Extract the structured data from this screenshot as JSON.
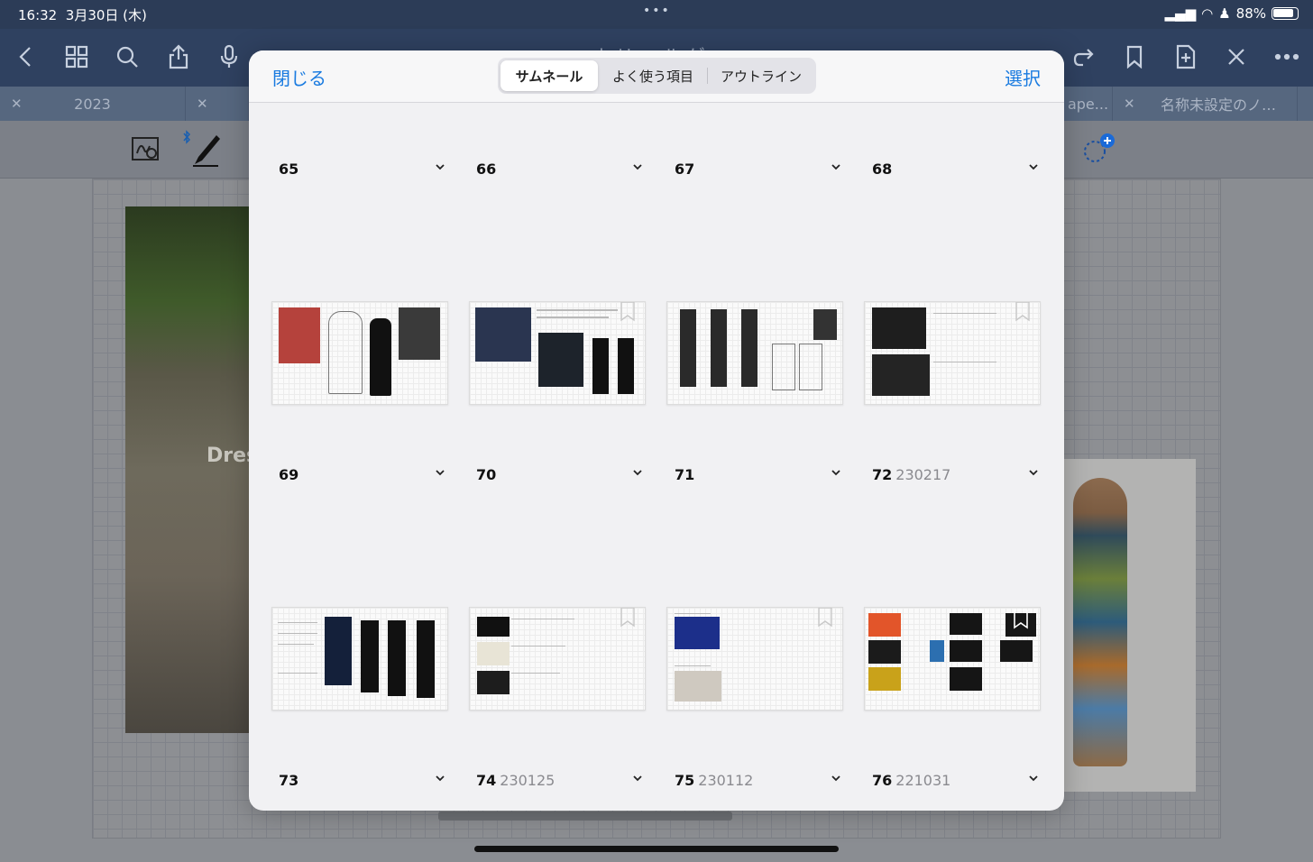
{
  "status_bar": {
    "time": "16:32",
    "date": "3月30日 (木)",
    "battery": "88%"
  },
  "app": {
    "title": "ー ナ リ ー ル ゲ"
  },
  "tabs": [
    {
      "label": "2023"
    },
    {
      "label": ""
    },
    {
      "label": "ape..."
    },
    {
      "label": "名称未設定のノ…"
    }
  ],
  "canvas": {
    "overlay_text": "Dres"
  },
  "modal": {
    "close_label": "閉じる",
    "select_label": "選択",
    "segments": [
      "サムネール",
      "よく使う項目",
      "アウトライン"
    ],
    "active_segment": "サムネール"
  },
  "pages": [
    {
      "num": "65",
      "sub": ""
    },
    {
      "num": "66",
      "sub": ""
    },
    {
      "num": "67",
      "sub": ""
    },
    {
      "num": "68",
      "sub": ""
    },
    {
      "num": "69",
      "sub": ""
    },
    {
      "num": "70",
      "sub": ""
    },
    {
      "num": "71",
      "sub": ""
    },
    {
      "num": "72",
      "sub": "230217"
    },
    {
      "num": "73",
      "sub": ""
    },
    {
      "num": "74",
      "sub": "230125"
    },
    {
      "num": "75",
      "sub": "230112"
    },
    {
      "num": "76",
      "sub": "221031"
    }
  ],
  "colors": {
    "accent": "#1a7be0",
    "toolbar": "#2f4160"
  }
}
